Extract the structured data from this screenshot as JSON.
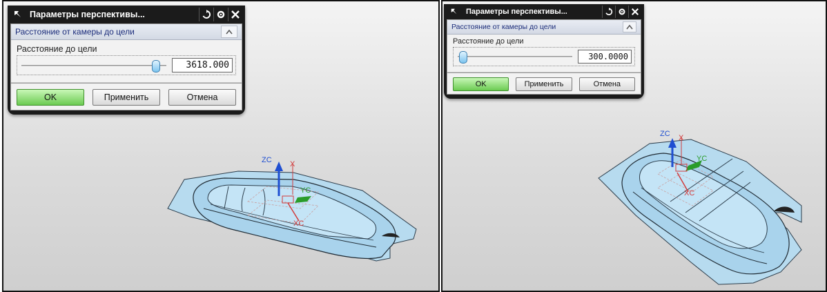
{
  "left_panel": {
    "dialog": {
      "title": "Параметры перспективы...",
      "section_title": "Расстояние от камеры до цели",
      "field_label": "Расстояние до цели",
      "value": "3618.000",
      "slider_position": 0.92,
      "buttons": {
        "ok": "OK",
        "apply": "Применить",
        "cancel": "Отмена"
      }
    },
    "axes": {
      "zc": "ZC",
      "x": "X",
      "yc": "YC",
      "xc": "XC"
    }
  },
  "right_panel": {
    "dialog": {
      "title": "Параметры перспективы...",
      "section_title": "Расстояние от камеры до цели",
      "field_label": "Расстояние до цели",
      "value": "300.0000",
      "slider_position": 0.06,
      "buttons": {
        "ok": "OK",
        "apply": "Применить",
        "cancel": "Отмена"
      }
    },
    "axes": {
      "zc": "ZC",
      "x": "X",
      "yc": "YC",
      "xc": "XC"
    }
  },
  "colors": {
    "part": "#a9d3ec",
    "part_dark": "#6aa3c6",
    "ok_button": "#7ed164",
    "zc_axis": "#1f4fd1",
    "x_axis": "#d23a3a",
    "yc_axis": "#2a9c2a"
  }
}
